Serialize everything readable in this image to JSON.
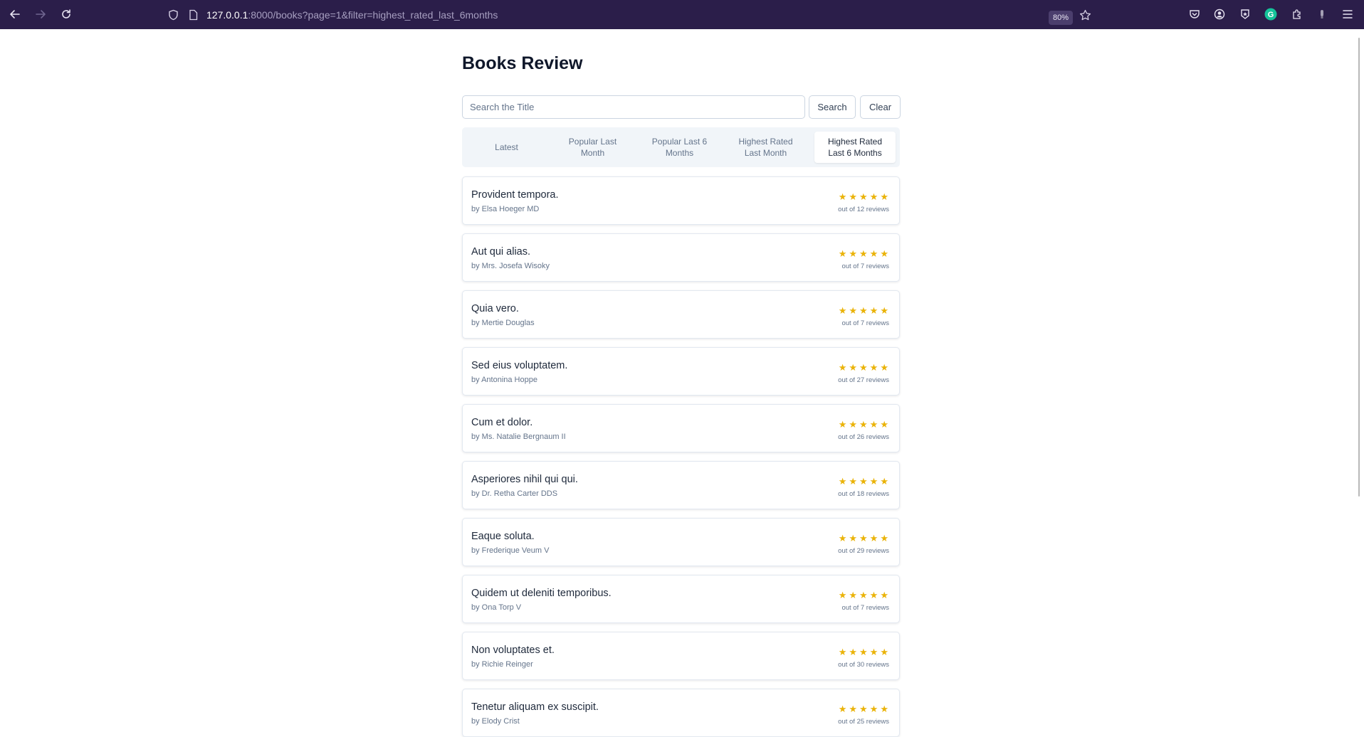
{
  "browser": {
    "url_host": "127.0.0.1",
    "url_rest": ":8000/books?page=1&filter=highest_rated_last_6months",
    "zoom": "80%"
  },
  "page": {
    "title": "Books Review",
    "search": {
      "placeholder": "Search the Title",
      "value": "",
      "search_label": "Search",
      "clear_label": "Clear"
    },
    "filters": [
      {
        "label": "Latest",
        "active": false
      },
      {
        "label": "Popular Last Month",
        "active": false
      },
      {
        "label": "Popular Last 6 Months",
        "active": false
      },
      {
        "label": "Highest Rated Last Month",
        "active": false
      },
      {
        "label": "Highest Rated Last 6 Months",
        "active": true
      }
    ],
    "books": [
      {
        "title": "Provident tempora.",
        "author": "by Elsa Hoeger MD",
        "rating": 5,
        "reviews": "out of 12 reviews"
      },
      {
        "title": "Aut qui alias.",
        "author": "by Mrs. Josefa Wisoky",
        "rating": 5,
        "reviews": "out of 7 reviews"
      },
      {
        "title": "Quia vero.",
        "author": "by Mertie Douglas",
        "rating": 5,
        "reviews": "out of 7 reviews"
      },
      {
        "title": "Sed eius voluptatem.",
        "author": "by Antonina Hoppe",
        "rating": 5,
        "reviews": "out of 27 reviews"
      },
      {
        "title": "Cum et dolor.",
        "author": "by Ms. Natalie Bergnaum II",
        "rating": 5,
        "reviews": "out of 26 reviews"
      },
      {
        "title": "Asperiores nihil qui qui.",
        "author": "by Dr. Retha Carter DDS",
        "rating": 5,
        "reviews": "out of 18 reviews"
      },
      {
        "title": "Eaque soluta.",
        "author": "by Frederique Veum V",
        "rating": 5,
        "reviews": "out of 29 reviews"
      },
      {
        "title": "Quidem ut deleniti temporibus.",
        "author": "by Ona Torp V",
        "rating": 5,
        "reviews": "out of 7 reviews"
      },
      {
        "title": "Non voluptates et.",
        "author": "by Richie Reinger",
        "rating": 5,
        "reviews": "out of 30 reviews"
      },
      {
        "title": "Tenetur aliquam ex suscipit.",
        "author": "by Elody Crist",
        "rating": 5,
        "reviews": "out of 25 reviews"
      }
    ],
    "colors": {
      "toolbar": "#2b1e4a",
      "star": "#eab308",
      "filter_bg": "#f1f5f9"
    }
  }
}
